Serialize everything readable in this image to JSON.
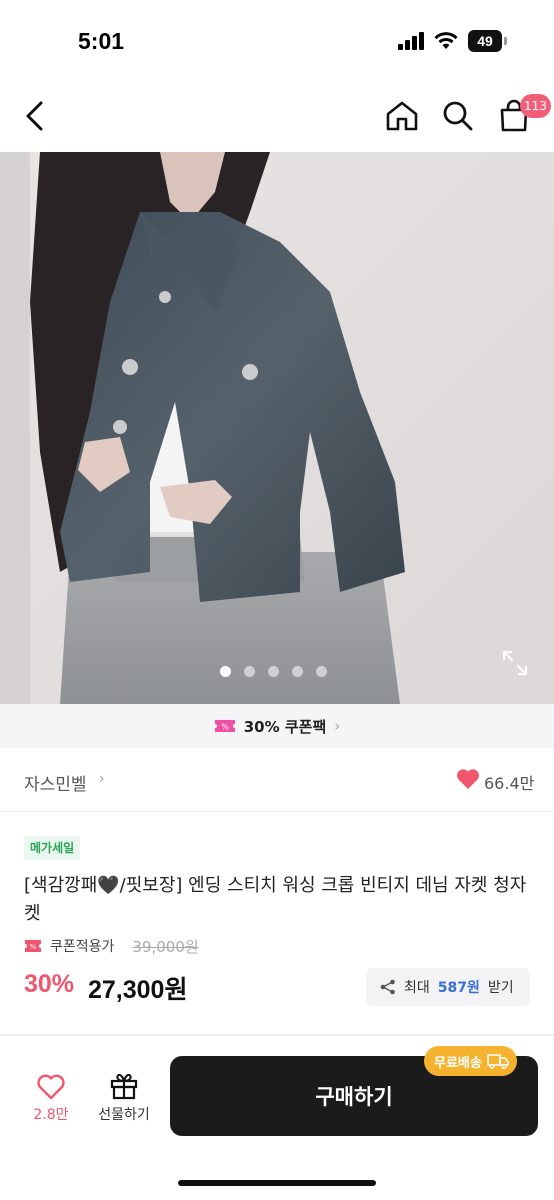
{
  "status_bar": {
    "time": "5:01",
    "battery": "49"
  },
  "nav": {
    "cart_count": "113"
  },
  "hero": {
    "slide_count": 5,
    "active_slide": 1
  },
  "coupon_strip": {
    "text": "30% 쿠폰팩"
  },
  "store": {
    "name": "자스민벨",
    "likes": "66.4만"
  },
  "product": {
    "badge": "메가세일",
    "title": "[색감깡패🖤/핏보장] 엔딩 스티치 워싱 크롭 빈티지 데님 자켓 청자켓",
    "coupon_label": "쿠폰적용가",
    "original_price": "39,000원",
    "discount": "30%",
    "price": "27,300원",
    "reward_prefix": "최대",
    "reward_amount": "587원",
    "reward_suffix": "받기"
  },
  "bottom_bar": {
    "wish_count": "2.8만",
    "gift_label": "선물하기",
    "buy_label": "구매하기",
    "free_shipping": "무료배송"
  },
  "colors": {
    "accent_pink": "#f0566d",
    "buy_button": "#1b1b1b",
    "free_ship": "#f5b22e",
    "mega_green": "#2aa355"
  }
}
